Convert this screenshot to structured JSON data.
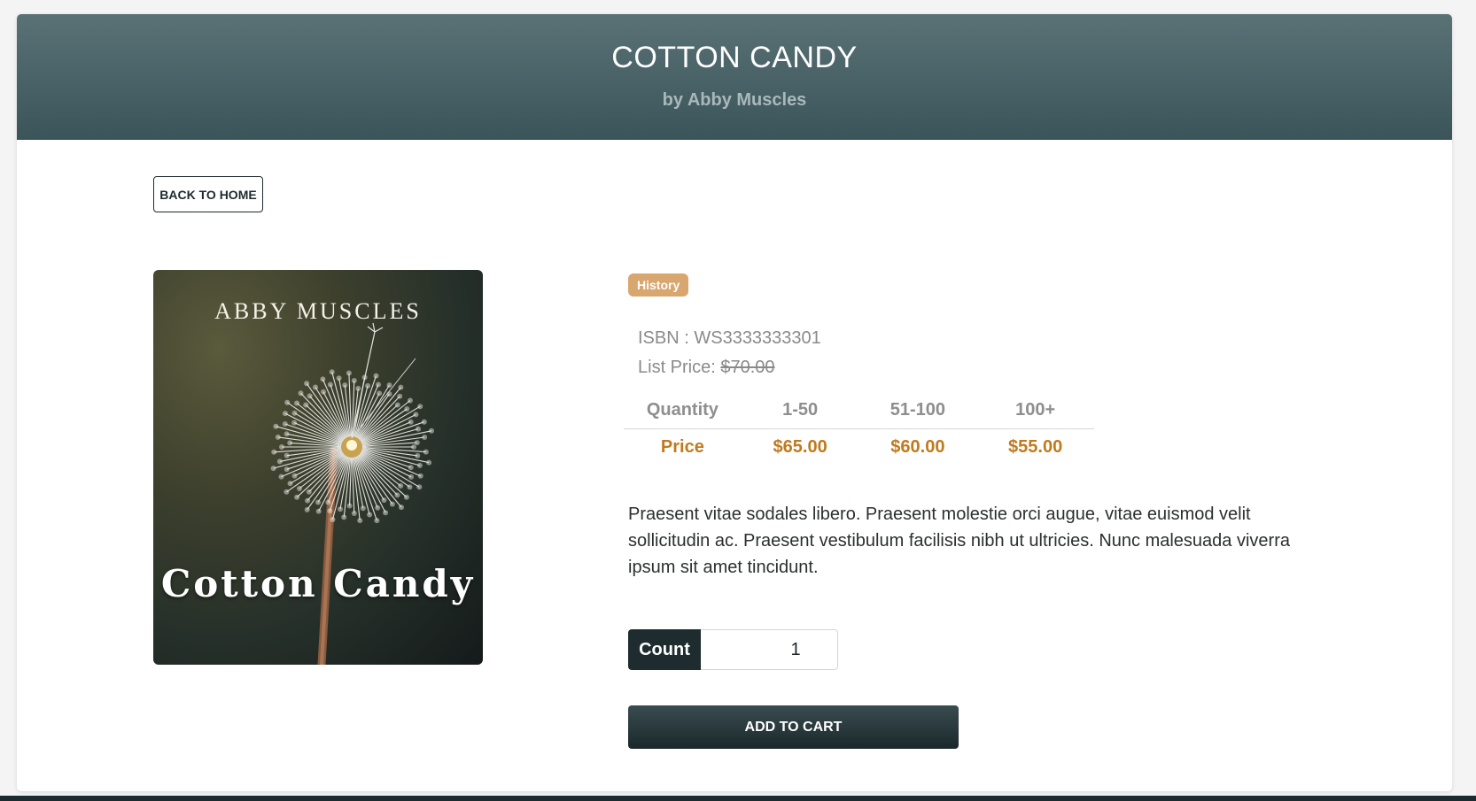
{
  "header": {
    "title": "COTTON CANDY",
    "author_line": "by Abby Muscles"
  },
  "nav": {
    "back_label": "BACK TO HOME"
  },
  "cover": {
    "author": "ABBY MUSCLES",
    "title": "Cotton Candy"
  },
  "product": {
    "category": "History",
    "isbn_label": "ISBN : WS3333333301",
    "list_price_label": "List Price:",
    "list_price": "$70.00",
    "description": "Praesent vitae sodales libero. Praesent molestie orci augue, vitae euismod velit sollicitudin ac. Praesent vestibulum facilisis nibh ut ultricies. Nunc malesuada viverra ipsum sit amet tincidunt."
  },
  "pricing": {
    "quantity_header": "Quantity",
    "price_header": "Price",
    "tiers": [
      {
        "range": "1-50",
        "price": "$65.00"
      },
      {
        "range": "51-100",
        "price": "$60.00"
      },
      {
        "range": "100+",
        "price": "$55.00"
      }
    ]
  },
  "cart": {
    "count_label": "Count",
    "count_value": "1",
    "add_label": "ADD TO CART"
  },
  "colors": {
    "banner": "#4a6266",
    "badge": "#d8a66f",
    "price": "#c07a1e",
    "dark": "#1e2c2f"
  }
}
